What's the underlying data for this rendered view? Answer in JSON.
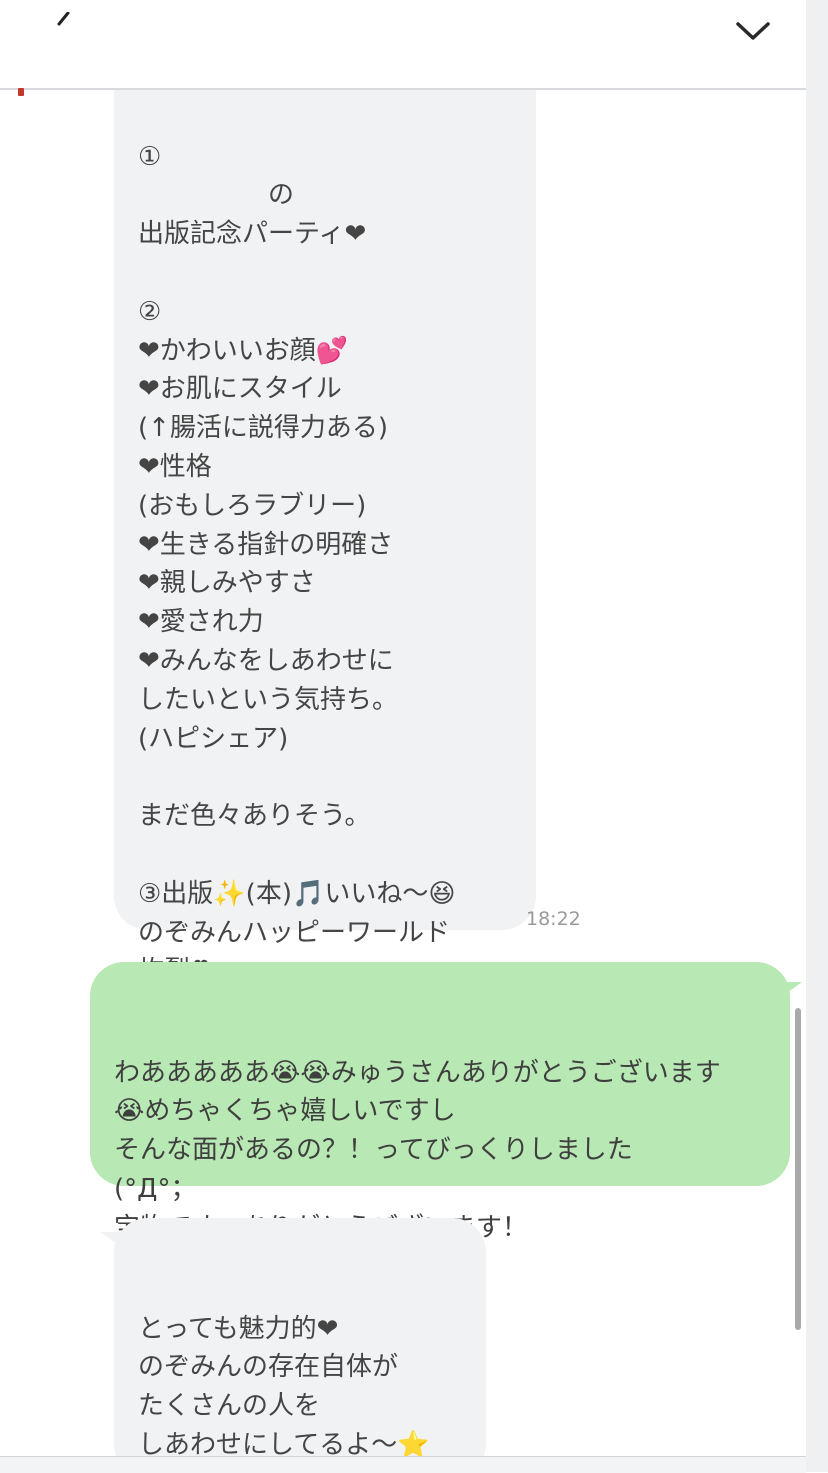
{
  "header": {
    "back_icon": "back-arrow-icon",
    "collapse_icon": "chevron-down-icon"
  },
  "messages": {
    "incoming_1": {
      "text": "①\n　　　　　の\n出版記念パーティ❤\n\n②\n❤かわいいお顔💕\n❤お肌にスタイル\n(↑腸活に説得力ある)\n❤性格\n(おもしろラブリー)\n❤生きる指針の明確さ\n❤親しみやすさ\n❤愛され力\n❤みんなをしあわせに\nしたいという気持ち。\n(ハピシェア)\n\nまだ色々ありそう。\n\n③出版✨(本)🎵いいね〜😆\nのぞみんハッピーワールド\n炸裂❣",
      "time": "18:22"
    },
    "outgoing_1": {
      "text": "わあああああ😭😭みゅうさんありがとうございます\n😭めちゃくちゃ嬉しいですし\nそんな面があるの？！ってびっくりしました\n(°Д°；\n宝物です、ありがとうございます！"
    },
    "incoming_2": {
      "text": "とっても魅力的❤\nのぞみんの存在自体が\nたくさんの人を\nしあわせにしてるよ〜⭐\nこれからも楽しみに\nしてまーす＼(^o^)／"
    }
  },
  "colors": {
    "incoming_bubble": "#f1f2f4",
    "outgoing_bubble": "#b8e8b4",
    "heart": "#f0535b",
    "timestamp": "#9a9a9a"
  }
}
